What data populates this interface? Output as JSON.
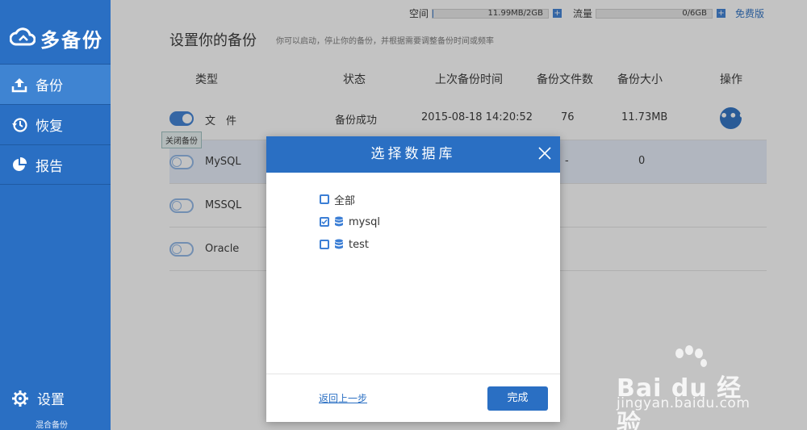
{
  "app": {
    "logo_text": "多备份",
    "nav": [
      {
        "label": "备份",
        "icon": "upload-icon",
        "active": true
      },
      {
        "label": "恢复",
        "icon": "history-icon",
        "active": false
      },
      {
        "label": "报告",
        "icon": "pie-chart-icon",
        "active": false
      }
    ],
    "settings_label": "设置",
    "mix_label": "混合备份"
  },
  "topbar": {
    "space_label": "空间",
    "space_value": "11.99MB/2GB",
    "space_fraction": 0.01,
    "traffic_label": "流量",
    "traffic_value": "0/6GB",
    "traffic_fraction": 0.0,
    "plus_symbol": "+",
    "free_label": "免费版"
  },
  "page": {
    "title": "设置你的备份",
    "subtitle": "你可以启动，停止你的备份，并根据需要调整备份时间或频率"
  },
  "table": {
    "headers": [
      "类型",
      "状态",
      "上次备份时间",
      "备份文件数",
      "备份大小",
      "操作"
    ],
    "rows": [
      {
        "type": "文　件",
        "enabled": true,
        "status": "备份成功",
        "last_time": "2015-08-18 14:20:52",
        "file_count": "76",
        "size": "11.73MB"
      },
      {
        "type": "MySQL",
        "enabled": false,
        "status": "",
        "last_time": "",
        "file_count": "-",
        "size": "0"
      },
      {
        "type": "MSSQL",
        "enabled": false,
        "status": "",
        "last_time": "",
        "file_count": "",
        "size": ""
      },
      {
        "type": "Oracle",
        "enabled": false,
        "status": "",
        "last_time": "",
        "file_count": "",
        "size": ""
      }
    ],
    "more_symbol": "•••",
    "tooltip": "关闭备份"
  },
  "modal": {
    "title": "选择数据库",
    "items": [
      {
        "label": "全部",
        "checked": false,
        "has_db_icon": false
      },
      {
        "label": "mysql",
        "checked": true,
        "has_db_icon": true
      },
      {
        "label": "test",
        "checked": false,
        "has_db_icon": true
      }
    ],
    "back_label": "返回上一步",
    "done_label": "完成"
  },
  "watermark": {
    "brand": "Bai du 经验",
    "url": "jingyan.baidu.com"
  },
  "colors": {
    "sidebar": "#2a6fc3",
    "sidebar_active": "#3f84d2",
    "accent": "#3b7ed5",
    "highlight_row": "#e6eefa"
  }
}
